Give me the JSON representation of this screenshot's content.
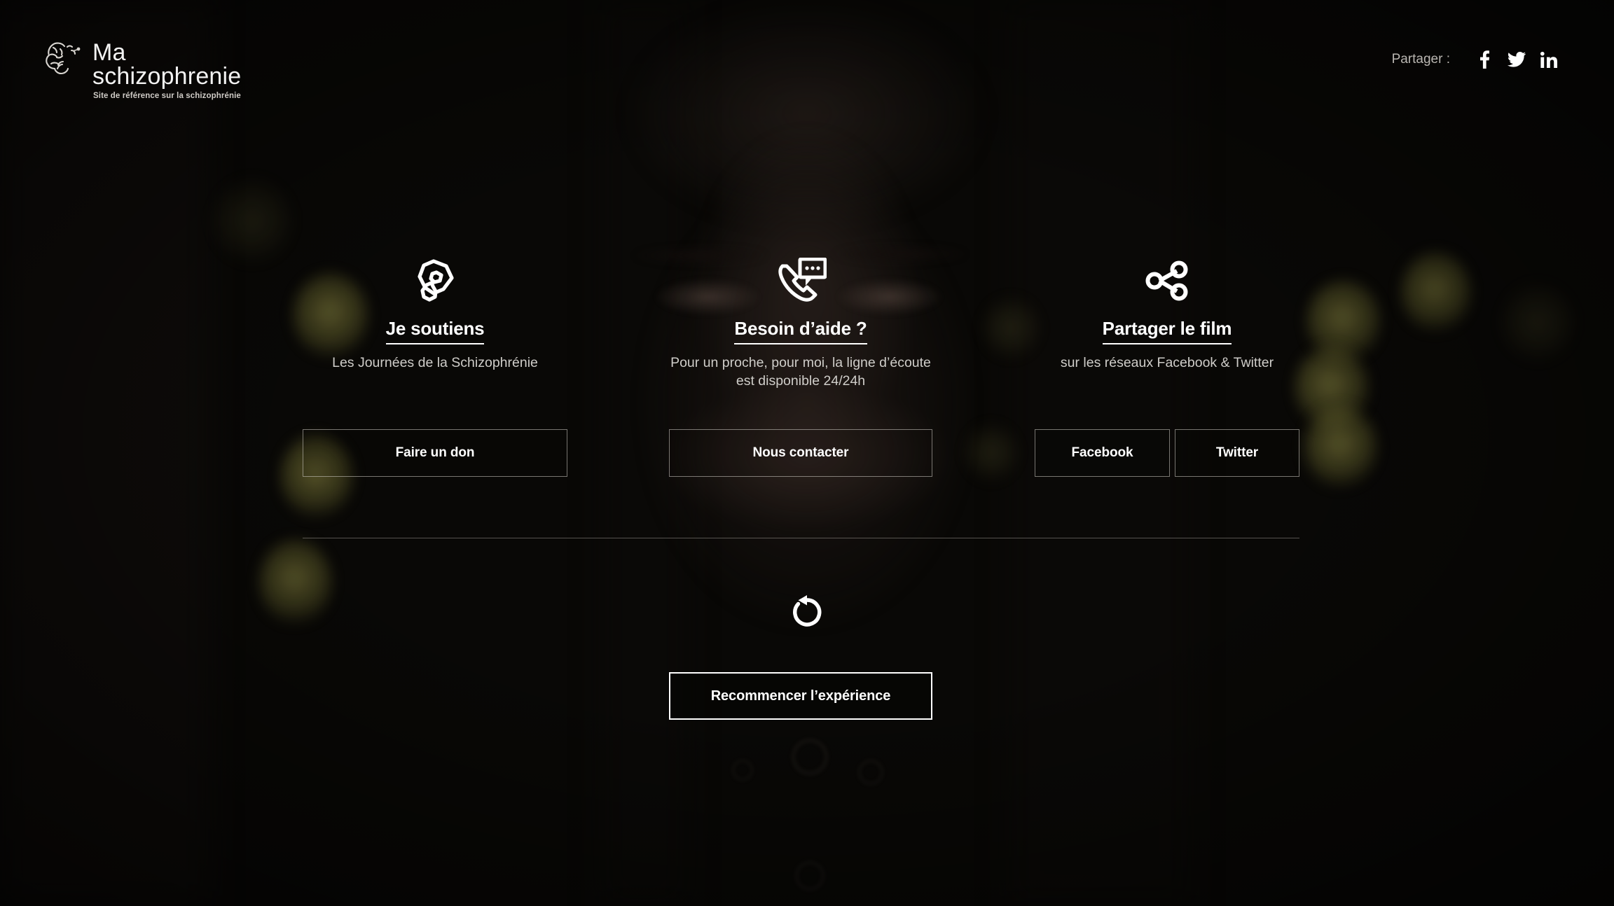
{
  "header": {
    "logo": {
      "icon": "brain-icon",
      "line1": "Ma",
      "line2": "schizophrenie",
      "tagline": "Site de référence sur la schizophrénie"
    },
    "share": {
      "label": "Partager :",
      "links": [
        {
          "name": "facebook",
          "icon": "facebook-icon"
        },
        {
          "name": "twitter",
          "icon": "twitter-icon"
        },
        {
          "name": "linkedin",
          "icon": "linkedin-icon"
        }
      ]
    }
  },
  "columns": [
    {
      "icon": "awareness-ribbon-icon",
      "title": "Je soutiens",
      "subtitle": "Les Journées de la Schizophrénie",
      "buttons": [
        {
          "label": "Faire un don"
        }
      ]
    },
    {
      "icon": "phone-chat-icon",
      "title": "Besoin d’aide ?",
      "subtitle": "Pour un proche, pour moi, la ligne d’écoute est disponible 24/24h",
      "buttons": [
        {
          "label": "Nous contacter"
        }
      ]
    },
    {
      "icon": "share-nodes-icon",
      "title": "Partager le film",
      "subtitle": "sur les réseaux Facebook & Twitter",
      "buttons": [
        {
          "label": "Facebook"
        },
        {
          "label": "Twitter"
        }
      ]
    }
  ],
  "restart": {
    "icon": "restart-arrow-icon",
    "label": "Recommencer l’expérience"
  },
  "colors": {
    "background": "#090806",
    "text": "#ffffff",
    "muted": "#cfcdc9",
    "border": "rgba(214,210,202,0.55)",
    "bokeh": "#a8a44e"
  }
}
